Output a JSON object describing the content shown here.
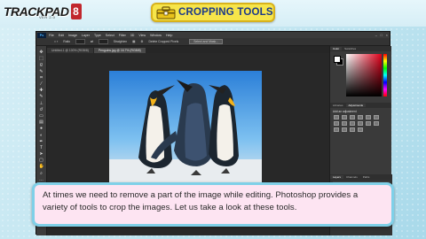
{
  "logo": {
    "text": "TRACKPAD",
    "sub": "VER 2.0",
    "badge": "8"
  },
  "title": "CROPPING TOOLS",
  "ps": {
    "app_icon": "Ps",
    "menu": [
      "File",
      "Edit",
      "Image",
      "Layer",
      "Type",
      "Select",
      "Filter",
      "3D",
      "View",
      "Window",
      "Help"
    ],
    "options": {
      "ratio_label": "Ratio",
      "straighten": "Straighten",
      "delete_cropped": "Delete Cropped Pixels",
      "select_mask": "Select and Mask..."
    },
    "tabs": [
      {
        "label": "Untitled-1 @ 100% (RGB/8)"
      },
      {
        "label": "Penguins.jpg @ 16.7% (RGB/8)"
      }
    ],
    "panels": {
      "color_tabs": [
        "Color",
        "Swatches"
      ],
      "adj_tabs": [
        "Libraries",
        "Adjustments"
      ],
      "adj_title": "Add an adjustment",
      "layer_tabs": [
        "Layers",
        "Channels",
        "Paths"
      ]
    }
  },
  "caption": "At times we need to remove a part of the image while editing. Photoshop provides a variety of tools to crop the images. Let us take a look at these tools."
}
